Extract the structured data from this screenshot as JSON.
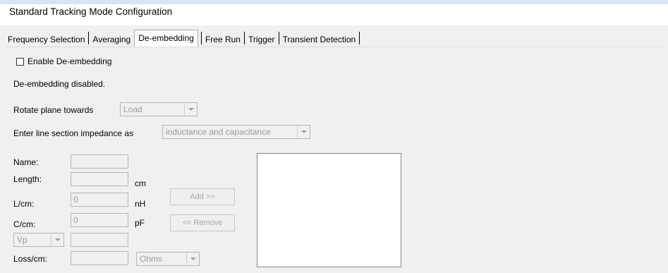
{
  "window": {
    "title": "Standard Tracking Mode Configuration"
  },
  "tabs": [
    {
      "label": "Frequency Selection",
      "active": false
    },
    {
      "label": "Averaging",
      "active": false
    },
    {
      "label": "De-embedding",
      "active": true
    },
    {
      "label": "Free Run",
      "active": false
    },
    {
      "label": "Trigger",
      "active": false
    },
    {
      "label": "Transient Detection",
      "active": false
    }
  ],
  "deembedding": {
    "enable_label": "Enable De-embedding",
    "enabled": false,
    "status_text": "De-embedding disabled.",
    "rotate_label": "Rotate plane towards",
    "rotate_value": "Load",
    "impedance_label": "Enter line section impedance as",
    "impedance_value": "inductance and capacitance"
  },
  "section": {
    "name_label": "Name:",
    "name_value": "",
    "length_label": "Length:",
    "length_value": "",
    "length_unit": "cm",
    "lcm_label": "L/cm:",
    "lcm_value": "0",
    "lcm_unit": "nH",
    "ccm_label": "C/cm:",
    "ccm_value": "0",
    "ccm_unit": "pF",
    "vp_value": "Vp",
    "vp_field": "",
    "loss_label": "Loss/cm:",
    "loss_value": "",
    "loss_unit_value": "Ohms"
  },
  "buttons": {
    "add_label": "Add >>",
    "remove_label": "<< Remove"
  },
  "sections_list": []
}
